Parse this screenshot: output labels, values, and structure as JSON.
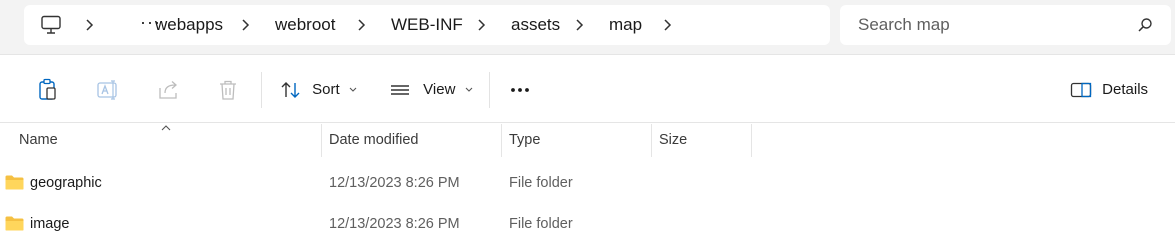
{
  "address_bar": {
    "overflow_label": "···",
    "breadcrumb": [
      "webapps",
      "webroot",
      "WEB-INF",
      "assets",
      "map"
    ]
  },
  "search": {
    "placeholder": "Search map"
  },
  "command_bar": {
    "sort_label": "Sort",
    "view_label": "View",
    "details_label": "Details"
  },
  "columns": {
    "name": "Name",
    "date_modified": "Date modified",
    "type": "Type",
    "size": "Size"
  },
  "files": [
    {
      "name": "geographic",
      "date_modified": "12/13/2023 8:26 PM",
      "type": "File folder",
      "size": ""
    },
    {
      "name": "image",
      "date_modified": "12/13/2023 8:26 PM",
      "type": "File folder",
      "size": ""
    }
  ],
  "colors": {
    "folder": "#f5c042",
    "accent": "#0067c0",
    "toolbar_bg": "#f3f3f3"
  }
}
